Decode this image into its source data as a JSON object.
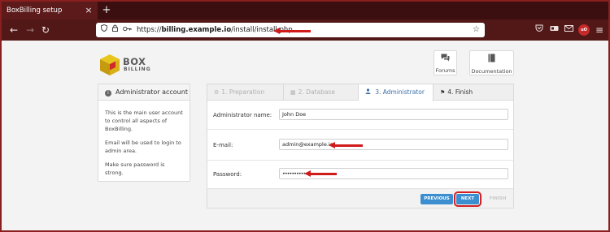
{
  "browser": {
    "tab_title": "BoxBilling setup",
    "tab_close": "×",
    "new_tab": "+",
    "url_scheme": "https://",
    "url_host": "billing.example.io",
    "url_path": "/install/install.php",
    "icons": {
      "back": "←",
      "forward": "→",
      "reload": "↻",
      "shield": "🛡",
      "lock": "🔒",
      "key": "⚿",
      "star": "☆",
      "pocket": "◙",
      "extension1": "▤",
      "extension2": "✉",
      "ublock": "uO",
      "menu": "≡"
    }
  },
  "header": {
    "logo_line1": "BOX",
    "logo_line2": "BILLING",
    "forums_label": "Forums",
    "documentation_label": "Documentation",
    "forums_icon": "▣",
    "docs_icon": "▤"
  },
  "sidebar": {
    "title": "Administrator account",
    "info_icon": "i",
    "paragraphs": [
      "This is the main user account to control all aspects of BoxBilling.",
      "Email will be used to login to admin area.",
      "Make sure password is strong."
    ]
  },
  "wizard": {
    "steps": [
      {
        "label": "1. Preparation",
        "icon": "⚙"
      },
      {
        "label": "2. Database",
        "icon": "▦"
      },
      {
        "label": "3. Administrator",
        "icon": "👤"
      },
      {
        "label": "4. Finish",
        "icon": "⚑"
      }
    ],
    "fields": {
      "name_label": "Administrator name:",
      "name_value": "John Doe",
      "email_label": "E-mail:",
      "email_value": "admin@example.io",
      "password_label": "Password:",
      "password_value": "••••••••••"
    },
    "buttons": {
      "previous": "PREVIOUS",
      "next": "NEXT",
      "finish": "FINISH"
    }
  },
  "annotation_color": "#d11a1a",
  "accent_color": "#3b8fd0"
}
